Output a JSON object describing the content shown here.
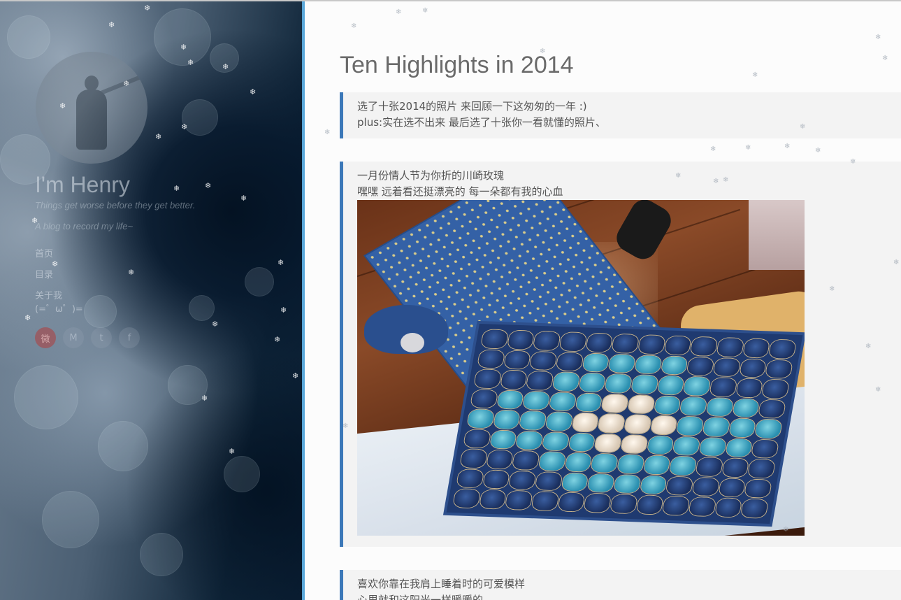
{
  "blog": {
    "title": "I'm Henry",
    "motto": "Things get worse before they get better.",
    "description": "A blog to record my life~"
  },
  "nav": {
    "items": [
      "首页",
      "目录",
      "关于我"
    ],
    "emoticon": "(=゜ω゜)="
  },
  "social": {
    "weibo": "微",
    "mail": "M",
    "twitter": "t",
    "facebook": "f"
  },
  "post": {
    "title": "Ten Highlights in 2014",
    "intro_line1": "选了十张2014的照片 来回顾一下这匆匆的一年 :)",
    "intro_line2": "plus:实在选不出来 最后选了十张你一看就懂的照片、",
    "highlights": [
      {
        "line1": "一月份情人节为你折的川崎玫瑰",
        "line2": "嘿嘿 远着看还挺漂亮的 每一朵都有我的心血"
      },
      {
        "line1": "喜欢你靠在我肩上睡着时的可爱模样",
        "line2": "心里就和这阳光一样暖暖的"
      }
    ]
  },
  "icons": {
    "snow": "❄"
  },
  "colors": {
    "accent_border": "#3b78b8",
    "sidebar_edge": "#5aa8da",
    "title": "#6a6a6a"
  }
}
